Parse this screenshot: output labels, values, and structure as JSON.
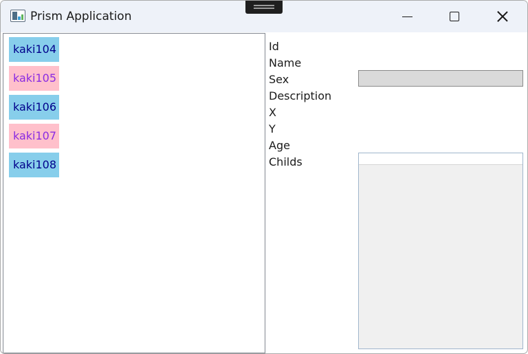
{
  "window": {
    "title": "Prism Application"
  },
  "list": {
    "items": [
      {
        "label": "kaki104",
        "color": "#87ceeb"
      },
      {
        "label": "kaki105",
        "color": "#ffc0cb"
      },
      {
        "label": "kaki106",
        "color": "#87ceeb"
      },
      {
        "label": "kaki107",
        "color": "#ffc0cb"
      },
      {
        "label": "kaki108",
        "color": "#87ceeb"
      }
    ]
  },
  "detail": {
    "labels": {
      "id": "Id",
      "name": "Name",
      "sex": "Sex",
      "description": "Description",
      "x": "X",
      "y": "Y",
      "age": "Age",
      "childs": "Childs"
    }
  },
  "icons": {
    "app": "app-icon",
    "minimize": "minimize-icon",
    "maximize": "maximize-icon",
    "close": "close-icon"
  }
}
